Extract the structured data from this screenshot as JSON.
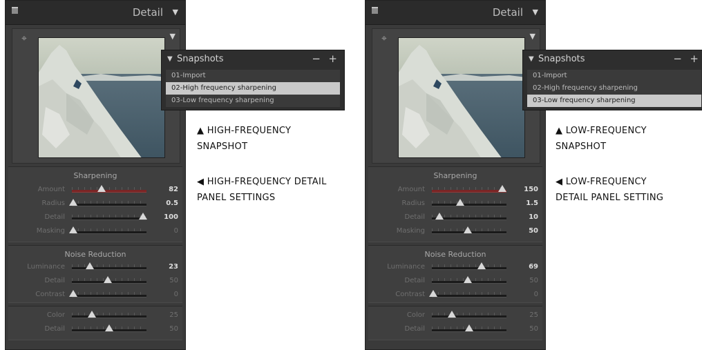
{
  "panels": [
    {
      "header_title": "Detail",
      "sharpening": {
        "title": "Sharpening",
        "rows": [
          {
            "label": "Amount",
            "value": "82",
            "frac": 0.4,
            "active": true,
            "red": true
          },
          {
            "label": "Radius",
            "value": "0.5",
            "frac": 0.02,
            "active": true,
            "red": false
          },
          {
            "label": "Detail",
            "value": "100",
            "frac": 0.95,
            "active": true,
            "red": false
          },
          {
            "label": "Masking",
            "value": "0",
            "frac": 0.02,
            "active": false,
            "red": false
          }
        ]
      },
      "noise": {
        "title": "Noise Reduction",
        "rows": [
          {
            "label": "Luminance",
            "value": "23",
            "frac": 0.24,
            "active": true
          },
          {
            "label": "Detail",
            "value": "50",
            "frac": 0.48,
            "active": false
          },
          {
            "label": "Contrast",
            "value": "0",
            "frac": 0.02,
            "active": false
          }
        ]
      },
      "color": {
        "rows": [
          {
            "label": "Color",
            "value": "25",
            "frac": 0.27,
            "active": false
          },
          {
            "label": "Detail",
            "value": "50",
            "frac": 0.5,
            "active": false
          }
        ]
      },
      "snapshots": {
        "title": "Snapshots",
        "minus": "−",
        "plus": "+",
        "items": [
          "01-Import",
          "02-High frequency sharpening",
          "03-Low frequency sharpening"
        ],
        "selected_index": 1
      },
      "caption_top": [
        "▲  HIGH-FREQUENCY",
        "SNAPSHOT"
      ],
      "caption_bottom": [
        "◀  HIGH-FREQUENCY DETAIL",
        "PANEL SETTINGS"
      ]
    },
    {
      "header_title": "Detail",
      "sharpening": {
        "title": "Sharpening",
        "rows": [
          {
            "label": "Amount",
            "value": "150",
            "frac": 0.94,
            "active": true,
            "red": true
          },
          {
            "label": "Radius",
            "value": "1.5",
            "frac": 0.38,
            "active": true,
            "red": false
          },
          {
            "label": "Detail",
            "value": "10",
            "frac": 0.1,
            "active": true,
            "red": false
          },
          {
            "label": "Masking",
            "value": "50",
            "frac": 0.48,
            "active": true,
            "red": false
          }
        ]
      },
      "noise": {
        "title": "Noise Reduction",
        "rows": [
          {
            "label": "Luminance",
            "value": "69",
            "frac": 0.67,
            "active": true
          },
          {
            "label": "Detail",
            "value": "50",
            "frac": 0.48,
            "active": false
          },
          {
            "label": "Contrast",
            "value": "0",
            "frac": 0.02,
            "active": false
          }
        ]
      },
      "color": {
        "rows": [
          {
            "label": "Color",
            "value": "25",
            "frac": 0.27,
            "active": false
          },
          {
            "label": "Detail",
            "value": "50",
            "frac": 0.5,
            "active": false
          }
        ]
      },
      "snapshots": {
        "title": "Snapshots",
        "minus": "−",
        "plus": "+",
        "items": [
          "01-Import",
          "02-High frequency sharpening",
          "03-Low frequency sharpening"
        ],
        "selected_index": 2
      },
      "caption_top": [
        "▲  LOW-FREQUENCY",
        "SNAPSHOT"
      ],
      "caption_bottom": [
        "◀  LOW-FREQUENCY",
        "DETAIL PANEL SETTING"
      ]
    }
  ]
}
